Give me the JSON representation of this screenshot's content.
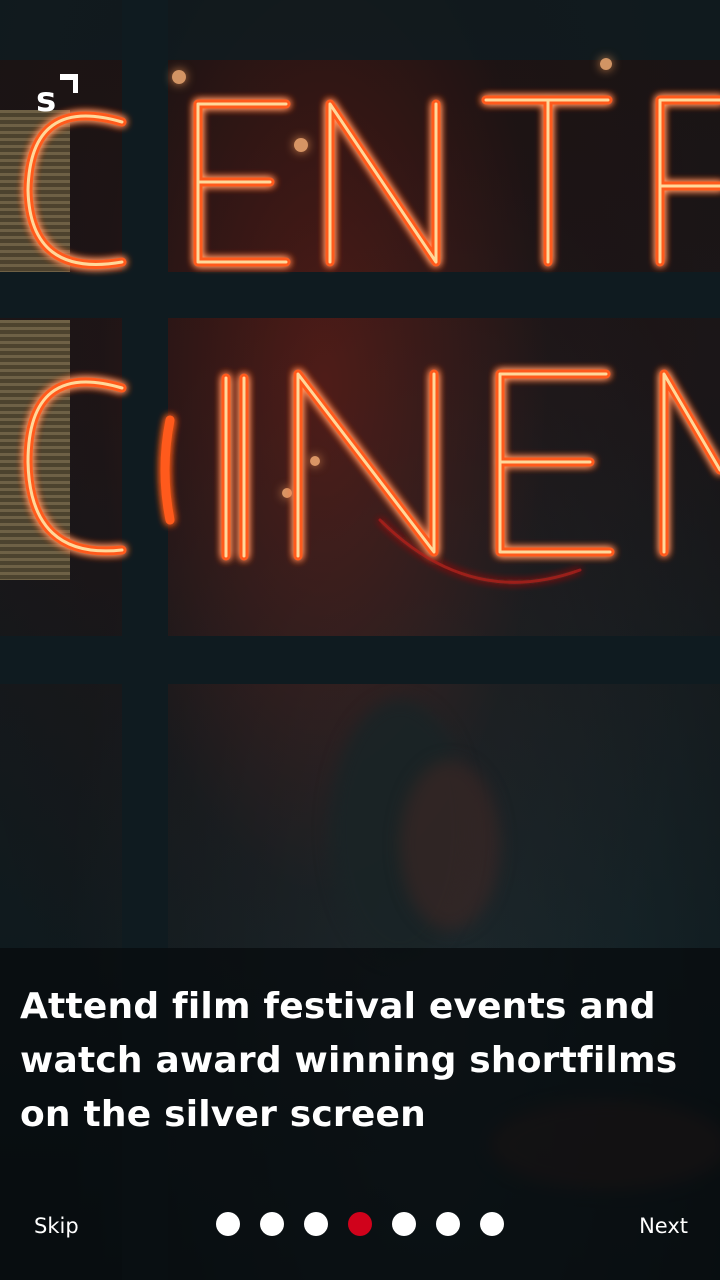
{
  "brand": {
    "logo": "s-bracket-logo"
  },
  "background": {
    "image": "neon-central-cinema-sign"
  },
  "slide": {
    "caption": "Attend film festival events and watch award winning shortfilms on the silver screen"
  },
  "pager": {
    "total": 7,
    "active_index": 3,
    "active_color": "#d0021b",
    "inactive_color": "#ffffff"
  },
  "nav": {
    "skip_label": "Skip",
    "next_label": "Next"
  }
}
